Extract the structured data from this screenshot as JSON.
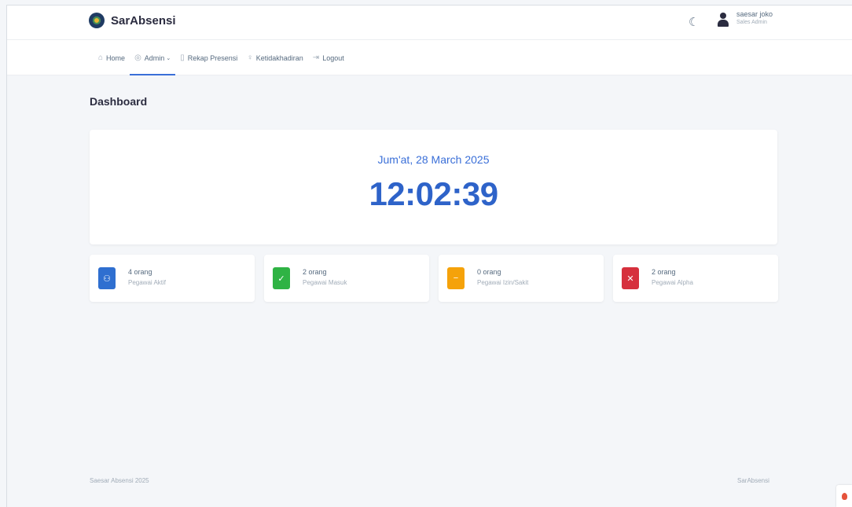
{
  "app": {
    "name": "SarAbsensi"
  },
  "user": {
    "name": "saesar joko",
    "role": "Sales Admin"
  },
  "nav": [
    {
      "label": "Home",
      "icon": "home-icon"
    },
    {
      "label": "Admin",
      "icon": "user-circle-icon",
      "active": true,
      "dropdown": true
    },
    {
      "label": "Rekap Presensi",
      "icon": "clipboard-icon"
    },
    {
      "label": "Ketidakhadiran",
      "icon": "person-icon"
    },
    {
      "label": "Logout",
      "icon": "logout-icon"
    }
  ],
  "page": {
    "title": "Dashboard"
  },
  "clock": {
    "date": "Jum'at, 28 March 2025",
    "time": "12:02:39"
  },
  "stats": [
    {
      "count": "4 orang",
      "label": "Pegawai Aktif",
      "color": "#2f6fd0",
      "icon": "users-icon"
    },
    {
      "count": "2 orang",
      "label": "Pegawai Masuk",
      "color": "#2fb344",
      "icon": "user-check-icon"
    },
    {
      "count": "0 orang",
      "label": "Pegawai Izin/Sakit",
      "color": "#f5a20a",
      "icon": "user-minus-icon"
    },
    {
      "count": "2 orang",
      "label": "Pegawai Alpha",
      "color": "#d6303d",
      "icon": "user-x-icon"
    }
  ],
  "footer": {
    "left": "Saesar Absensi 2025",
    "right": "SarAbsensi"
  }
}
